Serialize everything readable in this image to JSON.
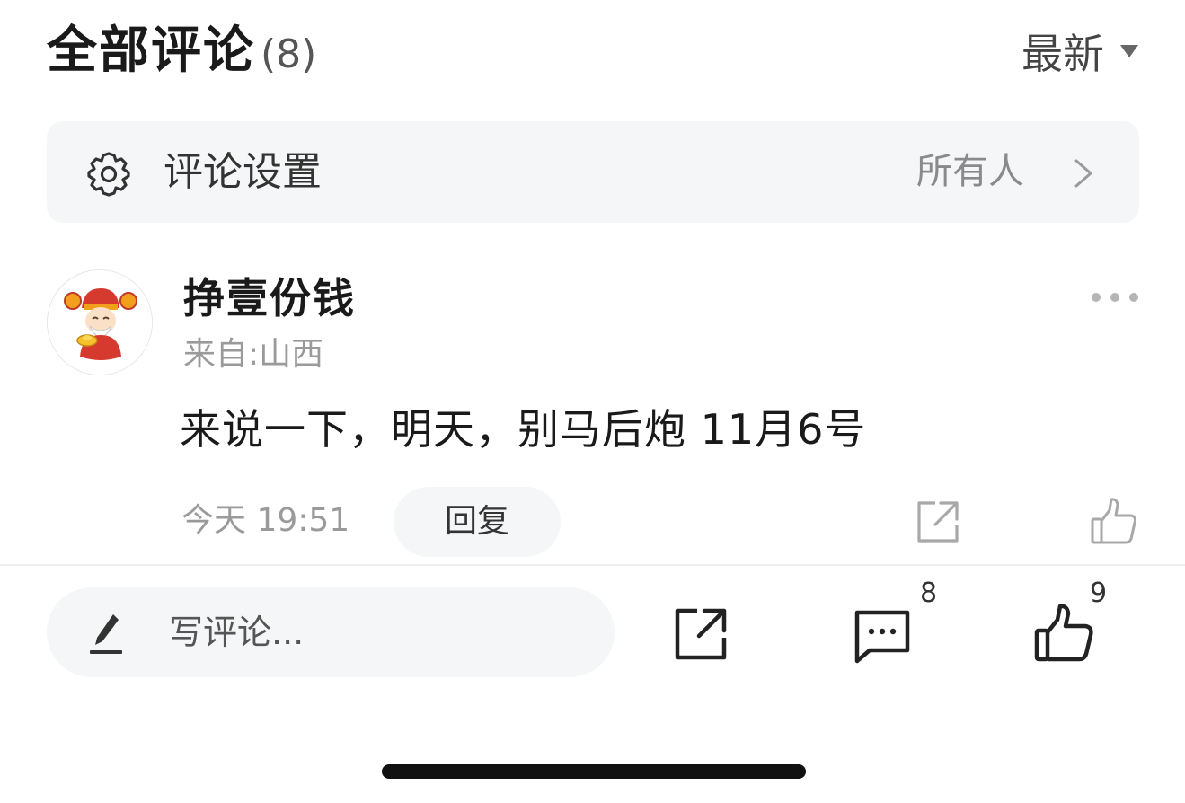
{
  "header": {
    "title": "全部评论",
    "count": "(8)",
    "sort_label": "最新"
  },
  "settings": {
    "label": "评论设置",
    "value": "所有人"
  },
  "comment": {
    "username": "挣壹份钱",
    "origin": "来自:山西",
    "text": "来说一下，明天，别马后炮 11月6号",
    "time": "今天 19:51",
    "reply_label": "回复"
  },
  "bottom_bar": {
    "placeholder": "写评论...",
    "comment_count": "8",
    "like_count": "9"
  },
  "colors": {
    "panel_bg": "#f5f6f7",
    "text_primary": "#1a1a1a",
    "text_secondary": "#9a9a9a",
    "icon_stroke": "#222222",
    "icon_light": "#a8a8a8"
  }
}
